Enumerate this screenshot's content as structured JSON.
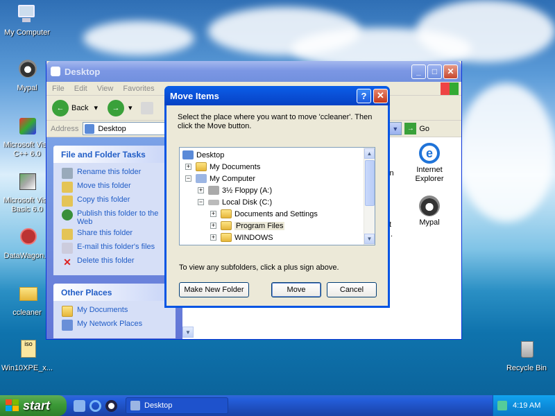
{
  "desktop": {
    "icons": [
      {
        "label": "My Computer"
      },
      {
        "label": "Mypal"
      },
      {
        "label": "Microsoft Visu C++ 6.0"
      },
      {
        "label": "Microsoft Visu Basic 6.0"
      },
      {
        "label": "DataWagon..."
      },
      {
        "label": "ccleaner"
      },
      {
        "label": "Win10XPE_x..."
      },
      {
        "label": "Recycle Bin"
      }
    ]
  },
  "explorer": {
    "title": "Desktop",
    "menu": [
      "File",
      "Edit",
      "View",
      "Favorites"
    ],
    "back_label": "Back",
    "address_label": "Address",
    "address_value": "Desktop",
    "go_label": "Go",
    "tasks_header": "File and Folder Tasks",
    "tasks": [
      "Rename this folder",
      "Move this folder",
      "Copy this folder",
      "Publish this folder to the Web",
      "Share this folder",
      "E-mail this folder's files",
      "Delete this folder"
    ],
    "places_header": "Other Places",
    "places": [
      "My Documents",
      "My Network Places"
    ],
    "content_items": [
      {
        "label": "Internet Explorer"
      },
      {
        "label": "Mypal"
      }
    ],
    "partial_labels": [
      "in",
      "t",
      "."
    ]
  },
  "dialog": {
    "title": "Move Items",
    "help_label": "?",
    "instruction": "Select the place where you want to move 'ccleaner'. Then click the Move button.",
    "tree": [
      {
        "label": "Desktop"
      },
      {
        "label": "My Documents"
      },
      {
        "label": "My Computer"
      },
      {
        "label": "3½ Floppy (A:)"
      },
      {
        "label": "Local Disk (C:)"
      },
      {
        "label": "Documents and Settings"
      },
      {
        "label": "Program Files"
      },
      {
        "label": "WINDOWS"
      }
    ],
    "hint": "To view any subfolders, click a plus sign above.",
    "new_folder_button": "Make New Folder",
    "move_button": "Move",
    "cancel_button": "Cancel"
  },
  "taskbar": {
    "start_label": "start",
    "task_label": "Desktop",
    "clock": "4:19 AM"
  }
}
